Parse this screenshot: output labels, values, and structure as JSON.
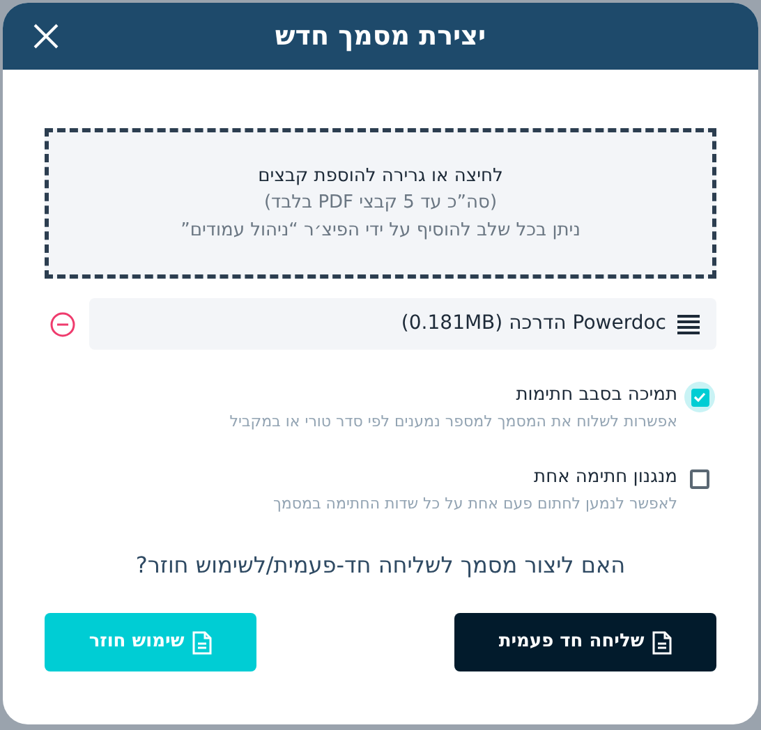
{
  "dialog": {
    "title": "יצירת מסמך חדש"
  },
  "dropzone": {
    "heading": "לחיצה או גרירה להוספת קבצים",
    "limit": "(סה”כ עד 5 קבצי PDF בלבד)",
    "hint": "ניתן בכל שלב להוסיף על ידי הפיצ׳ר “ניהול עמודים”"
  },
  "files": [
    {
      "name": "Powerdoc הדרכה (0.181MB)"
    }
  ],
  "options": [
    {
      "label": "תמיכה בסבב חתימות",
      "description": "אפשרות לשלוח את המסמך למספר נמענים לפי סדר טורי או במקביל",
      "checked": true
    },
    {
      "label": "מנגנון חתימה אחת",
      "description": "לאפשר לנמען לחתום פעם אחת על כל שדות החתימה במסמך",
      "checked": false
    }
  ],
  "question": "האם ליצור מסמך לשליחה חד-פעמית/לשימוש חוזר?",
  "buttons": [
    {
      "label": "שליחה חד פעמית",
      "kind": "primary"
    },
    {
      "label": "שימוש חוזר",
      "kind": "secondary"
    }
  ]
}
